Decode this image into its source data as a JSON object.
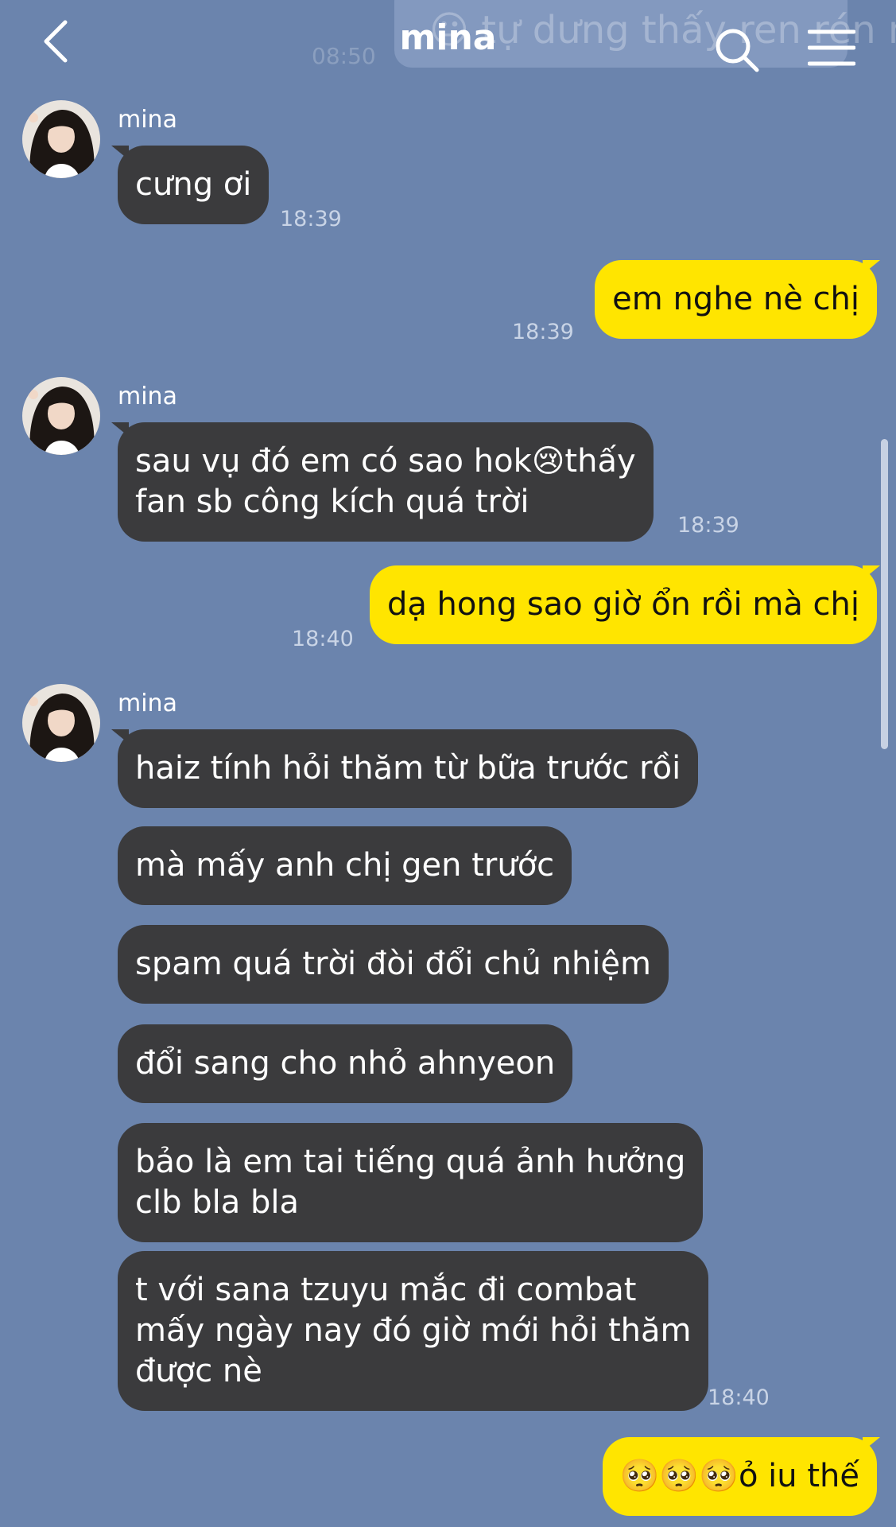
{
  "header": {
    "title": "mina",
    "ghost_preview": "😐 tự dưng thấy ren rén nha",
    "ghost_time": "08:50"
  },
  "icons": {
    "back": "chevron-left-icon",
    "search": "search-icon",
    "menu": "hamburger-menu-icon"
  },
  "colors": {
    "background": "#6b84ad",
    "incoming_bubble": "#3b3b3d",
    "outgoing_bubble": "#ffe500"
  },
  "messages": [
    {
      "sender": "mina",
      "text": "cưng ơi",
      "time": "18:39"
    },
    {
      "text": "em nghe nè chị",
      "time": "18:39"
    },
    {
      "sender": "mina",
      "text": "sau vụ đó em có sao hok😢thấy\nfan sb công kích quá trời",
      "time": "18:39"
    },
    {
      "text": "dạ hong sao giờ ổn rồi mà chị",
      "time": "18:40"
    },
    {
      "sender": "mina",
      "text": "haiz tính hỏi thăm từ bữa trước rồi"
    },
    {
      "text": "mà mấy anh chị gen trước"
    },
    {
      "text": "spam quá trời đòi đổi chủ nhiệm"
    },
    {
      "text": "đổi sang cho nhỏ ahnyeon"
    },
    {
      "text": "bảo là em tai tiếng quá ảnh hưởng\nclb bla bla"
    },
    {
      "text": "t với sana tzuyu mắc đi combat\nmấy ngày nay đó giờ mới hỏi thăm\nđược nè",
      "time": "18:40"
    },
    {
      "text": "🥺🥺🥺ỏ iu thế"
    }
  ]
}
